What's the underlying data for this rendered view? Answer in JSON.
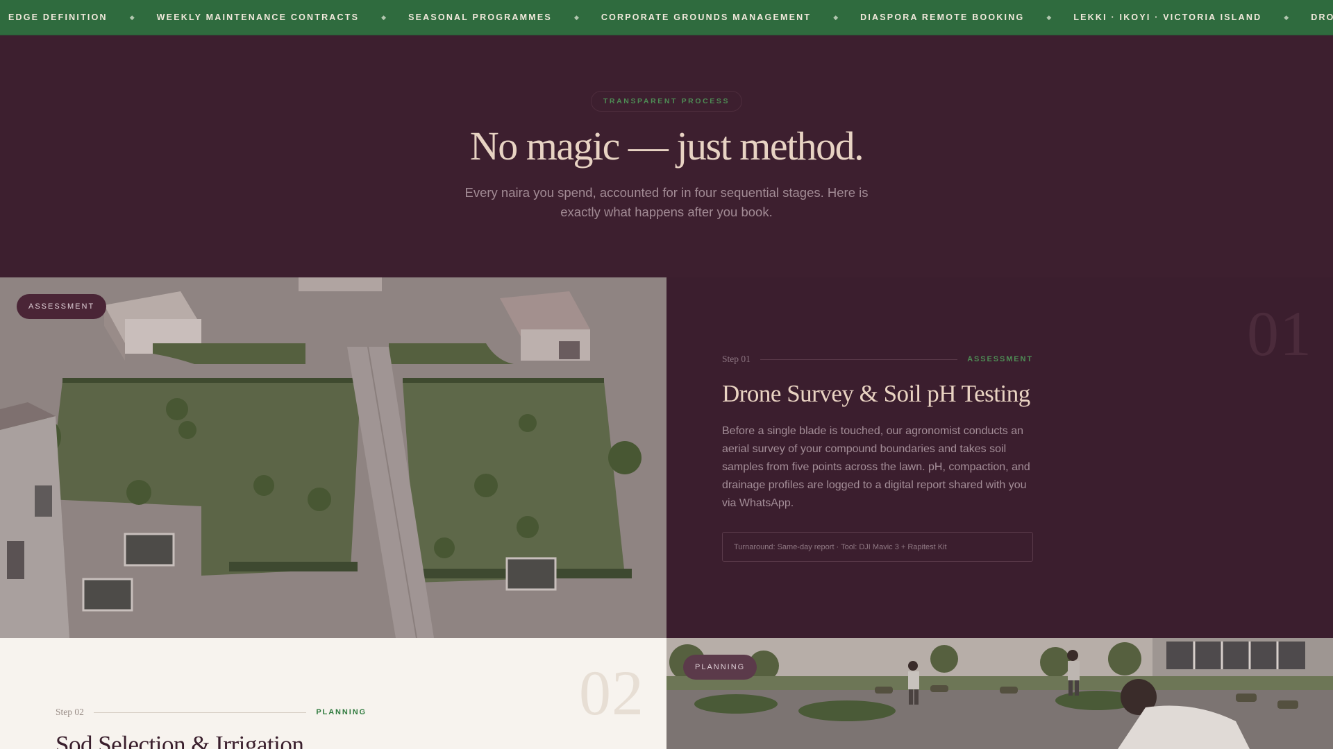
{
  "ticker": {
    "items": [
      "Edge Definition",
      "Weekly Maintenance Contracts",
      "Seasonal Programmes",
      "Corporate Grounds Management",
      "Diaspora Remote Booking",
      "Lekki · Ikoyi · Victoria Island",
      "Drone Survey & Soil Analysis"
    ],
    "separator": "◆"
  },
  "intro": {
    "pill": "Transparent Process",
    "title": "No magic — just method.",
    "subtitle": "Every naira you spend, accounted for in four sequential stages. Here is exactly what happens after you book."
  },
  "steps": [
    {
      "tag": "Assessment",
      "big_number": "01",
      "step_label": "Step 01",
      "category": "Assessment",
      "title": "Drone Survey & Soil pH Testing",
      "body": "Before a single blade is touched, our agronomist conducts an aerial survey of your compound boundaries and takes soil samples from five points across the lawn. pH, compaction, and drainage profiles are logged to a digital report shared with you via WhatsApp.",
      "detail": "Turnaround: Same-day report · Tool: DJI Mavic 3 + Rapitest Kit"
    },
    {
      "tag": "Planning",
      "big_number": "02",
      "step_label": "Step 02",
      "category": "Planning",
      "title": "Sod Selection & Irrigation"
    }
  ],
  "colors": {
    "ticker_bg": "#2f6b3e",
    "section_dark": "#3d1f2f",
    "section_light": "#f7f3ee",
    "accent_green": "#4e8c55",
    "title_cream": "#e8d3c3"
  }
}
